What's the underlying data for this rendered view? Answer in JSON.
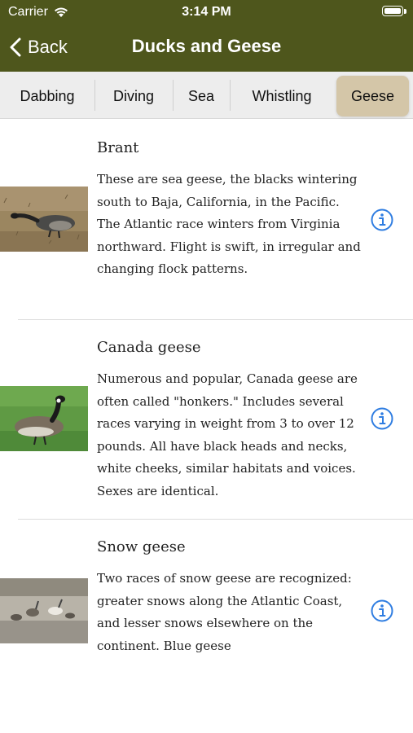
{
  "status_bar": {
    "carrier": "Carrier",
    "time": "3:14 PM"
  },
  "nav": {
    "back_label": "Back",
    "title": "Ducks and Geese"
  },
  "segments": [
    {
      "label": "Dabbing",
      "selected": false
    },
    {
      "label": "Diving",
      "selected": false
    },
    {
      "label": "Sea",
      "selected": false
    },
    {
      "label": "Whistling",
      "selected": false
    },
    {
      "label": "Geese",
      "selected": true
    }
  ],
  "birds": [
    {
      "name": "Brant",
      "description": "These are sea geese, the blacks wintering south to Baja, California, in the Pacific. The Atlantic race winters from Virginia northward. Flight is swift, in irregular and changing flock patterns."
    },
    {
      "name": "Canada geese",
      "description": "Numerous and popular, Canada geese are often called \"honkers.\" Includes several races varying in weight from 3 to over 12 pounds. All have black heads and necks, white cheeks, similar habitats and voices. Sexes are identical."
    },
    {
      "name": "Snow geese",
      "description": "Two races of snow geese are recognized: greater snows along the Atlantic Coast, and lesser snows elsewhere on the continent. Blue geese"
    }
  ],
  "colors": {
    "header": "#4e561c",
    "selected_segment": "#d4c6a8",
    "info_icon": "#2f7de1"
  },
  "icons": {
    "back": "chevron-left-icon",
    "info": "info-circle-icon",
    "wifi": "wifi-icon",
    "battery": "battery-icon"
  }
}
